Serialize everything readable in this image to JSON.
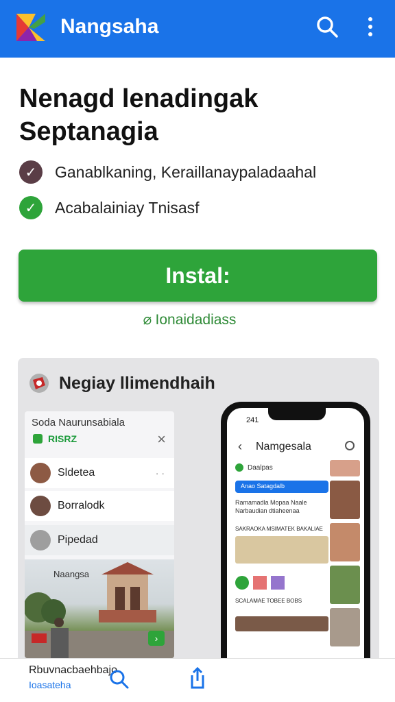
{
  "appbar": {
    "title": "Nangsaha",
    "bg": "#1a73e8"
  },
  "headline": {
    "line1": "Nenagd lenadingak",
    "line2": "Septanagia"
  },
  "features": [
    {
      "text": "Ganablkaning, Keraillanaypaladaahal",
      "icon": "check-dark-icon",
      "color": "#5a3d46"
    },
    {
      "text": "Acabalainiay Tnisasf",
      "icon": "check-green-icon",
      "color": "#2ea43a"
    }
  ],
  "install": {
    "label": "Instal:",
    "color": "#2ea43a"
  },
  "note": {
    "text": "Ionaidadiass"
  },
  "card": {
    "title": "Negiay llimendhaih",
    "panel": {
      "title": "Soda Naurunsabiala",
      "badge": "RISRZ",
      "rows": [
        "Sldetea",
        "Borralodk",
        "Pipedad"
      ],
      "scene_caption": "Naangsa"
    },
    "phone": {
      "time": "241",
      "title": "Namgesala",
      "chip": "Daalpas",
      "banner": "Anao Satagdalb",
      "text1": "Ramamadla Mopaa Naale Narbaudian dtiaheenaa",
      "section1": "SAKRAOKA MSIMATEK BAKALIAE",
      "section2": "SCALAMAE TOBEE BOBS"
    }
  },
  "bottom_nav": {
    "line1": "Rbuvnacbaehbajo",
    "line2": "Ioasateha"
  }
}
